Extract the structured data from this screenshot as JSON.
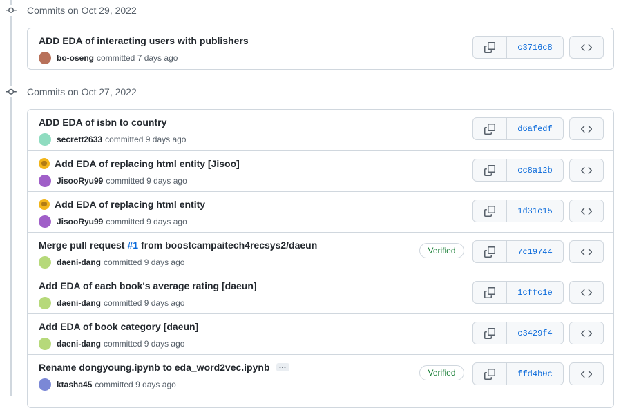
{
  "groups": [
    {
      "title": "Commits on Oct 29, 2022",
      "commits": [
        {
          "message": "ADD EDA of interacting users with publishers",
          "author": "bo-oseng",
          "action": "committed",
          "time": "7 days ago",
          "sha": "c3716c8",
          "avatar_color": "#b8715a",
          "emoji": false,
          "verified": false
        }
      ]
    },
    {
      "title": "Commits on Oct 27, 2022",
      "commits": [
        {
          "message": "ADD EDA of isbn to country",
          "author": "secrett2633",
          "action": "committed",
          "time": "9 days ago",
          "sha": "d6afedf",
          "avatar_color": "#8fdcc0",
          "emoji": false,
          "verified": false
        },
        {
          "message": "Add EDA of replacing html entity [Jisoo]",
          "author": "JisooRyu99",
          "action": "committed",
          "time": "9 days ago",
          "sha": "cc8a12b",
          "avatar_color": "#a05fc8",
          "emoji": true,
          "verified": false
        },
        {
          "message": "Add EDA of replacing html entity",
          "author": "JisooRyu99",
          "action": "committed",
          "time": "9 days ago",
          "sha": "1d31c15",
          "avatar_color": "#a05fc8",
          "emoji": true,
          "verified": false
        },
        {
          "message_before": "Merge pull request ",
          "pr_link": "#1",
          "message_after": " from boostcampaitech4recsys2/daeun",
          "author": "daeni-dang",
          "action": "committed",
          "time": "9 days ago",
          "sha": "7c19744",
          "avatar_color": "#b6d97a",
          "emoji": false,
          "verified": true
        },
        {
          "message": "Add EDA of each book's average rating [daeun]",
          "author": "daeni-dang",
          "action": "committed",
          "time": "9 days ago",
          "sha": "1cffc1e",
          "avatar_color": "#b6d97a",
          "emoji": false,
          "verified": false
        },
        {
          "message": "Add EDA of book category [daeun]",
          "author": "daeni-dang",
          "action": "committed",
          "time": "9 days ago",
          "sha": "c3429f4",
          "avatar_color": "#b6d97a",
          "emoji": false,
          "verified": false
        },
        {
          "message": "Rename dongyoung.ipynb to eda_word2vec.ipynb",
          "author": "ktasha45",
          "action": "committed",
          "time": "9 days ago",
          "sha": "ffd4b0c",
          "avatar_color": "#7b88d6",
          "emoji": false,
          "verified": true,
          "ellipsis": "…"
        }
      ]
    }
  ],
  "labels": {
    "verified": "Verified"
  },
  "icons": {
    "commit": "commit-icon",
    "copy": "copy-icon",
    "browse": "code-icon"
  }
}
